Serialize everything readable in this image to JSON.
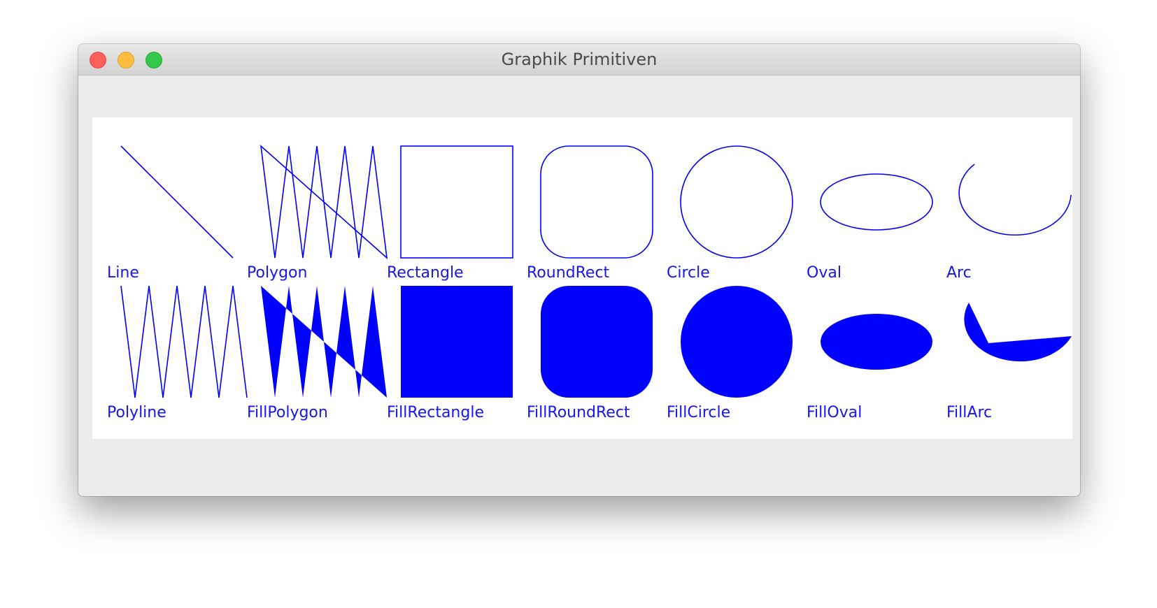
{
  "window": {
    "title": "Graphik Primitiven"
  },
  "colors": {
    "shape": "#0000ff",
    "label": "#1515f5",
    "canvas": "#ffffff",
    "window_bg": "#ececec",
    "close": "#fc605c",
    "minimize": "#fdbc40",
    "zoom": "#34c84a"
  },
  "primitives": {
    "row1": [
      "Line",
      "Polygon",
      "Rectangle",
      "RoundRect",
      "Circle",
      "Oval",
      "Arc"
    ],
    "row2": [
      "Polyline",
      "FillPolygon",
      "FillRectangle",
      "FillRoundRect",
      "FillCircle",
      "FillOval",
      "FillArc"
    ]
  }
}
